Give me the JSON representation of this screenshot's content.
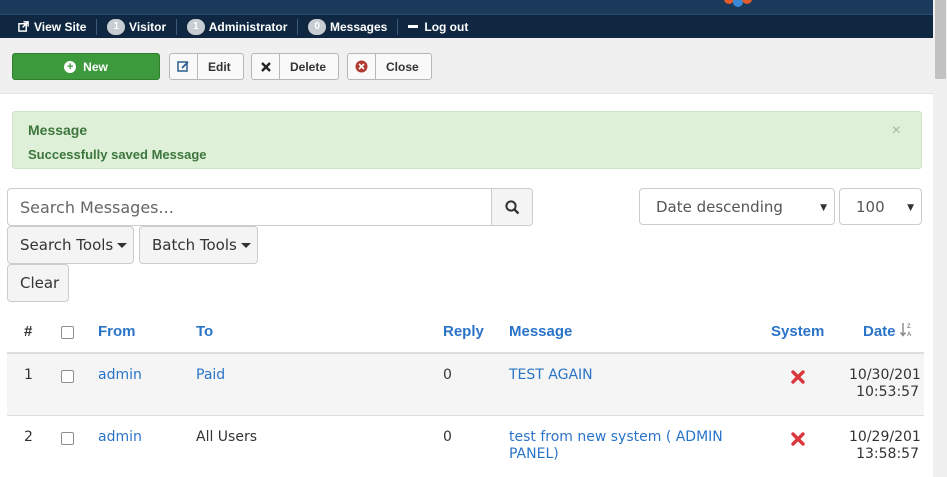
{
  "statusbar": {
    "view_site": "View Site",
    "visitor_count": "1",
    "visitor_label": "Visitor",
    "admin_count": "1",
    "admin_label": "Administrator",
    "messages_count": "0",
    "messages_label": "Messages",
    "logout_label": "Log out"
  },
  "toolbar": {
    "new_label": "New",
    "edit_label": "Edit",
    "delete_label": "Delete",
    "close_label": "Close"
  },
  "alert": {
    "title": "Message",
    "message": "Successfully saved Message",
    "close_symbol": "×"
  },
  "filters": {
    "search_placeholder": "Search Messages...",
    "sort_value": "Date descending",
    "limit_value": "100",
    "search_tools_label": "Search Tools",
    "batch_tools_label": "Batch Tools",
    "clear_label": "Clear"
  },
  "table": {
    "headers": {
      "num": "#",
      "from": "From",
      "to": "To",
      "reply": "Reply",
      "message": "Message",
      "system": "System",
      "date": "Date"
    },
    "rows": [
      {
        "num": "1",
        "from": "admin",
        "to": "Paid",
        "reply": "0",
        "message": "TEST AGAIN",
        "date": "10/30/201",
        "time": "10:53:57"
      },
      {
        "num": "2",
        "from": "admin",
        "to": "All Users",
        "reply": "0",
        "message_line1": "test from new system ( ADMIN",
        "message_line2": "PANEL)",
        "date": "10/29/201",
        "time": "13:58:57"
      }
    ]
  },
  "colors": {
    "navbar": "#0f2741",
    "success_green": "#3c9a3c",
    "link_blue": "#2a74c8",
    "alert_bg": "#dff0d8",
    "danger_red": "#d9373d"
  }
}
